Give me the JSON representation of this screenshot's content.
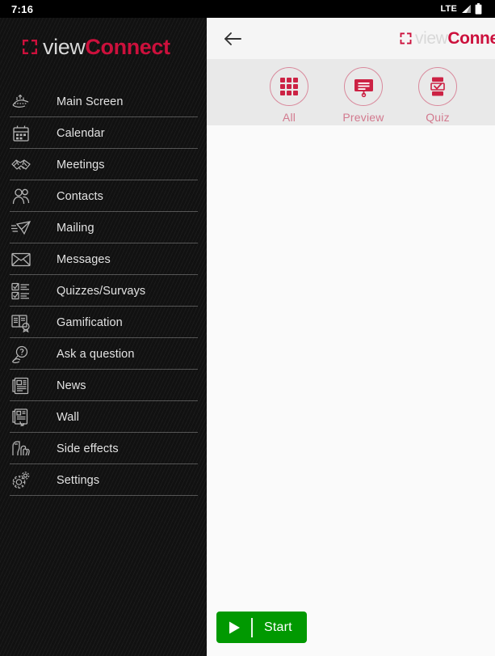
{
  "status_bar": {
    "time": "7:16",
    "network": "LTE",
    "signal_icon": "signal-bars-icon",
    "battery_icon": "battery-icon"
  },
  "brand": {
    "bracket_icon": "bracket-frame-icon",
    "part_light": "view",
    "part_bold": "Connect"
  },
  "colors": {
    "accent": "#cc103c",
    "tab_accent": "#cc2244",
    "tab_label": "#d2798e",
    "start_green": "#019901",
    "sidebar_bg": "#111111",
    "appbar_bg": "#f5f5f5",
    "tabstrip_bg": "#e9e9e9",
    "content_bg": "#fafafa"
  },
  "sidebar": {
    "items": [
      {
        "label": "Main Screen",
        "icon": "main-screen-icon"
      },
      {
        "label": "Calendar",
        "icon": "calendar-icon"
      },
      {
        "label": "Meetings",
        "icon": "handshake-icon"
      },
      {
        "label": "Contacts",
        "icon": "contacts-icon"
      },
      {
        "label": "Mailing",
        "icon": "mailing-icon"
      },
      {
        "label": "Messages",
        "icon": "envelope-icon"
      },
      {
        "label": "Quizzes/Survays",
        "icon": "checklist-icon"
      },
      {
        "label": "Gamification",
        "icon": "book-award-icon"
      },
      {
        "label": "Ask a question",
        "icon": "question-bubble-icon"
      },
      {
        "label": "News",
        "icon": "newspaper-icon"
      },
      {
        "label": "Wall",
        "icon": "wall-post-icon"
      },
      {
        "label": "Side effects",
        "icon": "side-effects-icon"
      },
      {
        "label": "Settings",
        "icon": "gear-icon"
      }
    ]
  },
  "appbar": {
    "back_icon": "back-arrow-icon"
  },
  "tabs": [
    {
      "label": "All",
      "icon": "grid-icon"
    },
    {
      "label": "Preview",
      "icon": "presentation-icon"
    },
    {
      "label": "Quiz",
      "icon": "quiz-checklist-icon"
    }
  ],
  "start_button": {
    "label": "Start",
    "play_icon": "play-icon"
  }
}
